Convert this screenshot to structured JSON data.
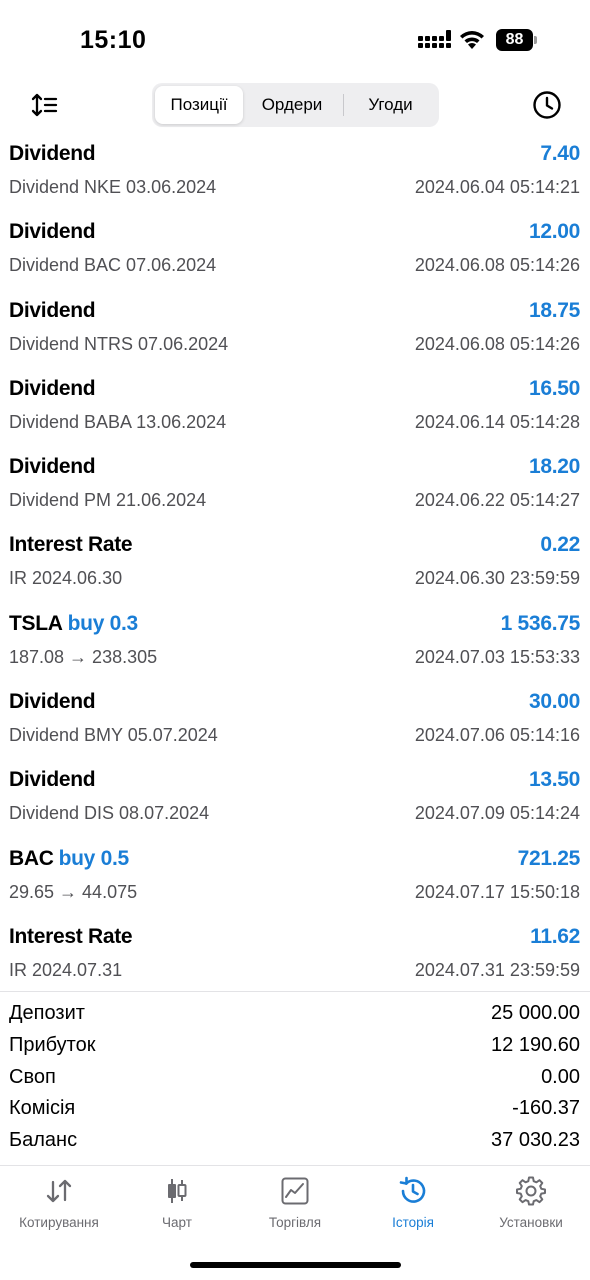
{
  "status_bar": {
    "time": "15:10",
    "battery": "88"
  },
  "toolbar": {
    "tabs": [
      {
        "label": "Позиції",
        "active": false
      },
      {
        "label": "Ордери",
        "active": false
      },
      {
        "label": "Угоди",
        "active": false
      }
    ],
    "selected": "Позиції"
  },
  "deals": [
    {
      "title": "Dividend",
      "action": "",
      "amount": "7.40",
      "subtitle": "Dividend NKE 03.06.2024",
      "time": "2024.06.04 05:14:21"
    },
    {
      "title": "Dividend",
      "action": "",
      "amount": "12.00",
      "subtitle": "Dividend BAC 07.06.2024",
      "time": "2024.06.08 05:14:26"
    },
    {
      "title": "Dividend",
      "action": "",
      "amount": "18.75",
      "subtitle": "Dividend NTRS 07.06.2024",
      "time": "2024.06.08 05:14:26"
    },
    {
      "title": "Dividend",
      "action": "",
      "amount": "16.50",
      "subtitle": "Dividend BABA 13.06.2024",
      "time": "2024.06.14 05:14:28"
    },
    {
      "title": "Dividend",
      "action": "",
      "amount": "18.20",
      "subtitle": "Dividend PM 21.06.2024",
      "time": "2024.06.22 05:14:27"
    },
    {
      "title": "Interest Rate",
      "action": "",
      "amount": "0.22",
      "subtitle": "IR 2024.06.30",
      "time": "2024.06.30 23:59:59"
    },
    {
      "title": "TSLA",
      "action": "buy 0.3",
      "amount": "1 536.75",
      "subtitle": "187.08 → 238.305",
      "time": "2024.07.03 15:53:33"
    },
    {
      "title": "Dividend",
      "action": "",
      "amount": "30.00",
      "subtitle": "Dividend BMY 05.07.2024",
      "time": "2024.07.06 05:14:16"
    },
    {
      "title": "Dividend",
      "action": "",
      "amount": "13.50",
      "subtitle": "Dividend DIS 08.07.2024",
      "time": "2024.07.09 05:14:24"
    },
    {
      "title": "BAC",
      "action": "buy 0.5",
      "amount": "721.25",
      "subtitle": "29.65 → 44.075",
      "time": "2024.07.17 15:50:18"
    },
    {
      "title": "Interest Rate",
      "action": "",
      "amount": "11.62",
      "subtitle": "IR 2024.07.31",
      "time": "2024.07.31 23:59:59"
    }
  ],
  "summary": [
    {
      "label": "Депозит",
      "value": "25 000.00"
    },
    {
      "label": "Прибуток",
      "value": "12 190.60"
    },
    {
      "label": "Своп",
      "value": "0.00"
    },
    {
      "label": "Комісія",
      "value": "-160.37"
    },
    {
      "label": "Баланс",
      "value": "37 030.23"
    }
  ],
  "tabbar": [
    {
      "label": "Котирування",
      "icon": "quotes-icon",
      "active": false
    },
    {
      "label": "Чарт",
      "icon": "chart-icon",
      "active": false
    },
    {
      "label": "Торгівля",
      "icon": "trade-icon",
      "active": false
    },
    {
      "label": "Історія",
      "icon": "history-icon",
      "active": true
    },
    {
      "label": "Установки",
      "icon": "settings-icon",
      "active": false
    }
  ],
  "colors": {
    "accent": "#1a7ed6",
    "secondary_text": "#505054",
    "tab_inactive": "#6b6b70"
  }
}
